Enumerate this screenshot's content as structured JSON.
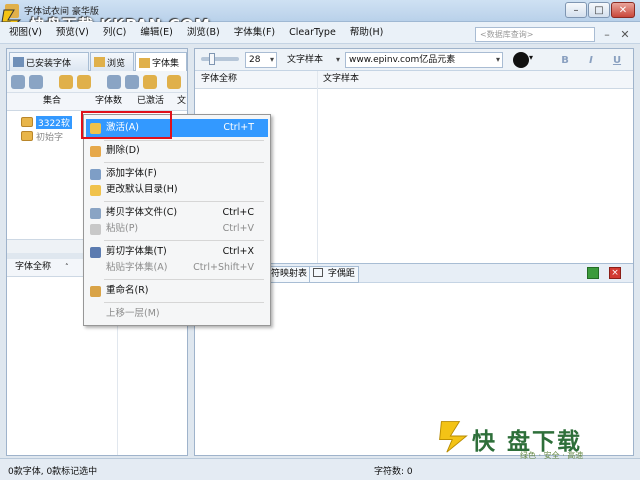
{
  "window": {
    "title": "字体试衣间 豪华版"
  },
  "watermark": {
    "brand": "快盘下载 KKPAN.COM",
    "brand2": "快 盘下载",
    "slogan": "绿色 · 安全 · 高速"
  },
  "menubar": {
    "items": [
      "视图(V)",
      "预览(V)",
      "列(C)",
      "编辑(E)",
      "浏览(B)",
      "字体集(F)",
      "ClearType",
      "帮助(H)"
    ]
  },
  "search": {
    "placeholder": "<数据库查询>"
  },
  "left_panel": {
    "tabs": [
      "已安装字体",
      "浏览",
      "字体集"
    ],
    "columns": [
      "集合",
      "字体数",
      "已激活",
      "文"
    ],
    "tree": [
      {
        "label": "3322软"
      },
      {
        "label": "初始字"
      }
    ],
    "lower_columns": [
      "字体全称"
    ]
  },
  "right_panel": {
    "font_size": "28",
    "sample_dropdown": "文字样本",
    "sample_text": "www.epinv.com亿品元素",
    "format_buttons": [
      "B",
      "I",
      "U"
    ],
    "columns": [
      "字体全称",
      "文字样本"
    ],
    "bottom_tabs": [
      "符映射表",
      "字偶距"
    ]
  },
  "context_menu": {
    "items": [
      {
        "label": "激活(A)",
        "shortcut": "Ctrl+T",
        "icon": "activate-icon",
        "disabled": false
      },
      {
        "label": "删除(D)",
        "shortcut": "",
        "icon": "delete-icon",
        "disabled": false
      },
      {
        "label": "添加字体(F)",
        "shortcut": "",
        "icon": "add-font-icon",
        "disabled": false
      },
      {
        "label": "更改默认目录(H)",
        "shortcut": "",
        "icon": "folder-icon",
        "disabled": false
      },
      {
        "label": "拷贝字体文件(C)",
        "shortcut": "Ctrl+C",
        "icon": "copy-icon",
        "disabled": false
      },
      {
        "label": "粘贴(P)",
        "shortcut": "Ctrl+V",
        "icon": "paste-icon",
        "disabled": true
      },
      {
        "label": "剪切字体集(T)",
        "shortcut": "Ctrl+X",
        "icon": "cut-icon",
        "disabled": false
      },
      {
        "label": "粘贴字体集(A)",
        "shortcut": "Ctrl+Shift+V",
        "icon": "",
        "disabled": true
      },
      {
        "label": "重命名(R)",
        "shortcut": "",
        "icon": "rename-icon",
        "disabled": false
      },
      {
        "label": "上移一层(M)",
        "shortcut": "",
        "icon": "",
        "disabled": true
      }
    ]
  },
  "statusbar": {
    "left": "0款字体, 0款标记选中",
    "right": "字符数: 0"
  },
  "colors": {
    "highlight": "#3399ff",
    "red_box": "#e0101a"
  }
}
